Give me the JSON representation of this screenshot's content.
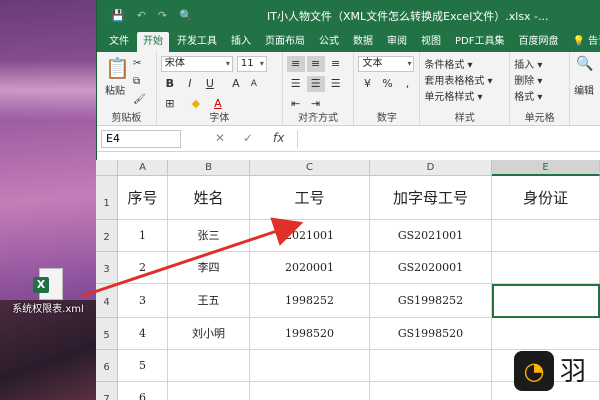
{
  "desktop": {
    "file_icon": {
      "badge": "X",
      "label": "系统权限表.xml"
    }
  },
  "titlebar": {
    "save_icon": "💾",
    "undo_icon": "↶",
    "redo_icon": "↷",
    "preview_icon": "🔍",
    "title": "IT小人物文件（XML文件怎么转换成Excel文件）.xlsx -..."
  },
  "tabs": [
    "文件",
    "开始",
    "开发工具",
    "插入",
    "页面布局",
    "公式",
    "数据",
    "审阅",
    "视图",
    "PDF工具集",
    "百度网盘"
  ],
  "tell_me": "告诉我",
  "ribbon": {
    "clipboard": {
      "paste": "粘贴",
      "label": "剪贴板"
    },
    "font": {
      "name": "宋体",
      "size": "11",
      "label": "字体",
      "bold": "B",
      "italic": "I",
      "underline": "U",
      "grow": "A",
      "shrink": "A",
      "fill_color": "A"
    },
    "alignment": {
      "label": "对齐方式"
    },
    "number": {
      "format": "文本",
      "percent": "%",
      "comma": ",",
      "label": "数字"
    },
    "styles": {
      "cond": "条件格式 ▾",
      "table": "套用表格格式 ▾",
      "cell": "单元格样式 ▾",
      "label": "样式"
    },
    "cells": {
      "insert": "插入 ▾",
      "delete": "删除 ▾",
      "format": "格式 ▾",
      "label": "单元格"
    },
    "editing": {
      "label": "编辑"
    }
  },
  "formula_bar": {
    "name_box": "E4",
    "cancel": "✕",
    "enter": "✓",
    "fx": "fx",
    "value": ""
  },
  "sheet": {
    "columns": [
      "A",
      "B",
      "C",
      "D",
      "E"
    ],
    "rows": [
      "1",
      "2",
      "3",
      "4",
      "5",
      "6",
      "7"
    ],
    "header": [
      "序号",
      "姓名",
      "工号",
      "加字母工号",
      "身份证"
    ],
    "data": [
      [
        "1",
        "张三",
        "2021001",
        "GS2021001",
        ""
      ],
      [
        "2",
        "李四",
        "2020001",
        "GS2020001",
        ""
      ],
      [
        "3",
        "王五",
        "1998252",
        "GS1998252",
        ""
      ],
      [
        "4",
        "刘小明",
        "1998520",
        "GS1998520",
        ""
      ],
      [
        "5",
        "",
        "",
        "",
        ""
      ],
      [
        "6",
        "",
        "",
        "",
        ""
      ]
    ]
  },
  "watermark": {
    "text": "羽"
  },
  "colors": {
    "excel_green": "#217346",
    "arrow": "#e0302a"
  }
}
